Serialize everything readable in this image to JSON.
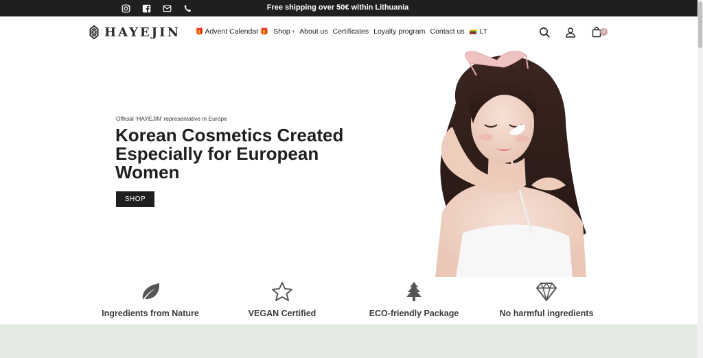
{
  "topbar": {
    "shipping_text": "Free shipping over 50€ within Lithuania",
    "socials": [
      "instagram-icon",
      "facebook-icon",
      "mail-icon",
      "phone-icon"
    ]
  },
  "header": {
    "logo_text": "HAYEJIN",
    "nav": {
      "advent_gift": "🎁",
      "advent": "Advent Calendar",
      "shop": "Shop",
      "about": "About us",
      "certificates": "Certificates",
      "loyalty": "Loyalty program",
      "contact": "Contact us",
      "language": "LT"
    },
    "cart_count": "0"
  },
  "hero": {
    "subtitle": "Official ‘HAYEJIN’ representative in Europe",
    "title": "Korean Cosmetics Created Especially for European Women",
    "button_label": "SHOP"
  },
  "features": [
    {
      "label": "Ingredients from Nature",
      "icon": "leaf-icon"
    },
    {
      "label": "VEGAN Certified",
      "icon": "star-icon"
    },
    {
      "label": "ECO-friendly Package",
      "icon": "tree-icon"
    },
    {
      "label": "No harmful ingredients",
      "icon": "diamond-icon"
    }
  ],
  "colors": {
    "dark": "#1f1f1f",
    "accent_badge": "#c9a7a0",
    "band": "#e4ebe3"
  }
}
